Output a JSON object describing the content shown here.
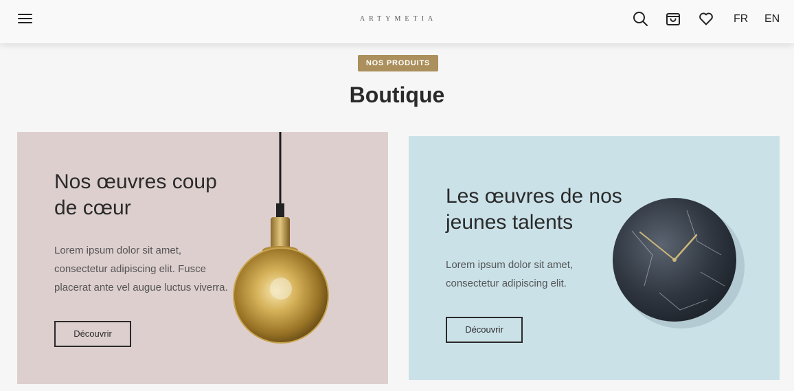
{
  "header": {
    "logo_text": "ARTYMETIA",
    "lang_fr": "FR",
    "lang_en": "EN",
    "icons": [
      "menu-icon",
      "search-icon",
      "shopping-bag-icon",
      "heart-icon"
    ]
  },
  "section": {
    "badge": "NOS PRODUITS",
    "title": "Boutique"
  },
  "cards": [
    {
      "title_lines": [
        "Nos œuvres coup",
        "de cœur"
      ],
      "text_lines": [
        "Lorem ipsum dolor sit amet,",
        "consectetur adipiscing elit. Fusce",
        "placerat ante vel augue luctus viverra."
      ],
      "button": "Découvrir",
      "background": "#decfcf",
      "image": "pendant-lamp"
    },
    {
      "title_lines": [
        "Les œuvres de nos",
        "jeunes talents"
      ],
      "text_lines": [
        "Lorem ipsum dolor sit amet,",
        "consectetur adipiscing elit."
      ],
      "button": "Découvrir",
      "background": "#cae1e8",
      "image": "marble-wall-clock"
    }
  ],
  "colors": {
    "badge": "#ab8f5c",
    "page_background": "#f6f6f6"
  }
}
